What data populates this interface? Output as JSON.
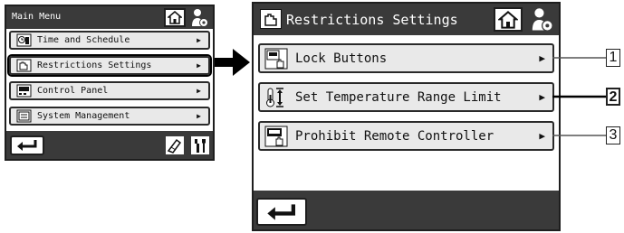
{
  "left_screen": {
    "title": "Main Menu",
    "items": [
      {
        "label": "Time and Schedule",
        "icon": "clock-calendar-icon"
      },
      {
        "label": "Restrictions Settings",
        "icon": "restriction-hand-icon"
      },
      {
        "label": "Control Panel",
        "icon": "control-panel-icon"
      },
      {
        "label": "System Management",
        "icon": "system-management-icon"
      }
    ],
    "arrow_glyph": "▶",
    "home_icon": "home-icon",
    "user_settings_icon": "user-settings-icon"
  },
  "right_screen": {
    "title": "Restrictions Settings",
    "items": [
      {
        "label": "Lock Buttons",
        "icon": "lock-buttons-icon"
      },
      {
        "label": "Set Temperature Range Limit",
        "icon": "temperature-range-icon"
      },
      {
        "label": "Prohibit Remote Controller",
        "icon": "prohibit-remote-icon"
      }
    ],
    "arrow_glyph": "▶"
  },
  "callouts": [
    "1",
    "2",
    "3"
  ],
  "colors": {
    "bar": "#3a3a3a",
    "item_bg": "#e9e9e9",
    "border": "#1e1e1e"
  }
}
